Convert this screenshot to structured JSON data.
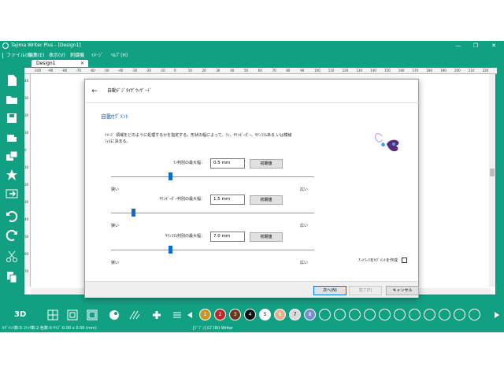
{
  "window": {
    "title": "Tajima Writer Plus - [Design1]",
    "controls": [
      "—",
      "❐",
      "✕"
    ]
  },
  "menu": {
    "items": [
      "ファイル(F)",
      "編集(E)",
      "表示(V)",
      "刺繍機",
      "ｲﾒｰｼﾞ",
      "ﾍﾙﾌﾟ(H)"
    ]
  },
  "tabs": {
    "active": "Design1",
    "close": "✕"
  },
  "ruler": {
    "h_ticks": [
      "-100",
      "-90",
      "-80",
      "-70",
      "-60",
      "-50",
      "-40",
      "-30",
      "-20",
      "-10",
      "0",
      "10",
      "20",
      "30",
      "40",
      "50",
      "60",
      "70",
      "80",
      "90",
      "100",
      "110",
      "120",
      "130",
      "140",
      "150",
      "160",
      "170",
      "180",
      "190",
      "200",
      "210",
      "220"
    ],
    "v_ticks": [
      "40",
      "30",
      "20",
      "10",
      "0",
      "10",
      "20",
      "30",
      "40",
      "50",
      "60",
      "70"
    ]
  },
  "dialog": {
    "back_label": "←",
    "title": "自動ﾃﾞｼﾞﾀｲｻﾞｳｨｻﾞｰﾄﾞ",
    "heading": "自動ｾｸﾞﾒﾝﾄ",
    "description": "ｲﾒｰｼﾞ 領域をどのように処理するかを指定する。形状の幅によって、ﾗﾝ、ｻﾃﾝﾎﾞｰﾀﾞｰ、ｻﾃﾝｺﾗﾑある いは模様ﾌｨﾙに決まる。",
    "rows": [
      {
        "label": "ﾗﾝ判別の最大幅：",
        "value": "0.5 mm",
        "reset": "初期値",
        "left": "狭い",
        "right": "広い",
        "position": 0.29
      },
      {
        "label": "ｻﾃﾝﾎﾞｰﾀﾞｰ判別の最大幅：",
        "value": "1.5 mm",
        "reset": "初期値",
        "left": "狭い",
        "right": "広い",
        "position": 0.11
      },
      {
        "label": "ｻﾃﾝｺﾗﾑ判別の最大幅：",
        "value": "7.0 mm",
        "reset": "初期値",
        "left": "狭い",
        "right": "広い",
        "position": 0.29
      }
    ],
    "checkbox_label": "ｱｰﾄﾜｰｸをｾｸﾞﾒﾝﾄを作成",
    "buttons": {
      "next": "次へ(N)",
      "finish": "完了(F)",
      "cancel": "キャンセル"
    }
  },
  "bottom": {
    "label_3d": "3D",
    "threads": [
      {
        "n": "1",
        "color": "#c8952a"
      },
      {
        "n": "2",
        "color": "#c0282d"
      },
      {
        "n": "3",
        "color": "#6b3a1f"
      },
      {
        "n": "4",
        "color": "#111111"
      },
      {
        "n": "5",
        "color": "#ffffff",
        "text_color": "#000000"
      },
      {
        "n": "6",
        "color": "#e8b08a"
      },
      {
        "n": "7",
        "color": "#d9d9d9",
        "text_color": "#000000"
      },
      {
        "n": "8",
        "color": "#7a8fd0"
      }
    ],
    "empty_threads": 13
  },
  "status": {
    "left": "ｾｸﾞﾒﾝﾄ数:0 ｽﾃｯﾁ数:2 色数:0 ｻｲｽﾞ:0.00 x 0.00 (mm)",
    "mid": "[ｼﾞﾌﾞﾝ] ﾛｺﾞ(Ri) Writer"
  },
  "colors": {
    "brand": "#12a083",
    "accent": "#0f6bd0"
  }
}
